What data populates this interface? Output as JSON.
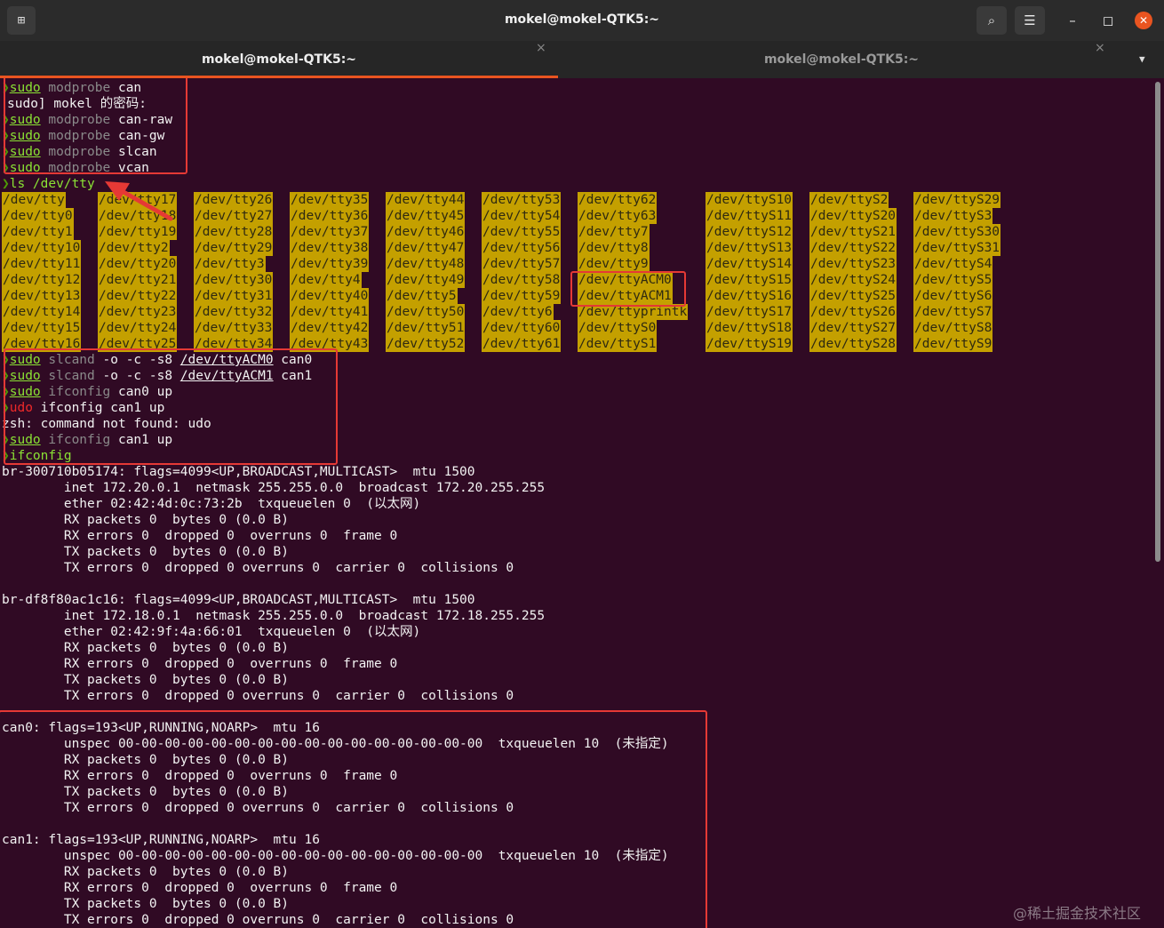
{
  "window": {
    "title": "mokel@mokel-QTK5:~",
    "tabs": [
      {
        "label": "mokel@mokel-QTK5:~",
        "close": "×"
      },
      {
        "label": "mokel@mokel-QTK5:~",
        "close": "×"
      }
    ],
    "new_tab_icon": "⊞",
    "search_icon": "⌕",
    "menu_icon": "☰",
    "minimize_icon": "–",
    "maximize_icon": "◻",
    "close_icon": "✕",
    "tab_dropdown_icon": "▼"
  },
  "colors": {
    "background": "#300a24",
    "accent": "#e95420",
    "highlight_box": "#e53935",
    "dir_bg": "#c4a000",
    "command": "#8ae234"
  },
  "prompt_arrow": "❯",
  "commands_block1": [
    {
      "cmd": "sudo",
      "rest1": "modprobe",
      "rest2": " can"
    },
    {
      "text": "sudo] mokel 的密码:"
    },
    {
      "cmd": "sudo",
      "rest1": "modprobe",
      "rest2": " can-raw"
    },
    {
      "cmd": "sudo",
      "rest1": "modprobe",
      "rest2": " can-gw"
    },
    {
      "cmd": "sudo",
      "rest1": "modprobe",
      "rest2": " slcan"
    },
    {
      "cmd": "sudo",
      "rest1": "modprobe",
      "rest2": " vcan"
    }
  ],
  "ls_command": "ls /dev/tty",
  "tty_columns": [
    [
      "/dev/tty",
      "/dev/tty0",
      "/dev/tty1",
      "/dev/tty10",
      "/dev/tty11",
      "/dev/tty12",
      "/dev/tty13",
      "/dev/tty14",
      "/dev/tty15",
      "/dev/tty16"
    ],
    [
      "/dev/tty17",
      "/dev/tty18",
      "/dev/tty19",
      "/dev/tty2",
      "/dev/tty20",
      "/dev/tty21",
      "/dev/tty22",
      "/dev/tty23",
      "/dev/tty24",
      "/dev/tty25"
    ],
    [
      "/dev/tty26",
      "/dev/tty27",
      "/dev/tty28",
      "/dev/tty29",
      "/dev/tty3",
      "/dev/tty30",
      "/dev/tty31",
      "/dev/tty32",
      "/dev/tty33",
      "/dev/tty34"
    ],
    [
      "/dev/tty35",
      "/dev/tty36",
      "/dev/tty37",
      "/dev/tty38",
      "/dev/tty39",
      "/dev/tty4",
      "/dev/tty40",
      "/dev/tty41",
      "/dev/tty42",
      "/dev/tty43"
    ],
    [
      "/dev/tty44",
      "/dev/tty45",
      "/dev/tty46",
      "/dev/tty47",
      "/dev/tty48",
      "/dev/tty49",
      "/dev/tty5",
      "/dev/tty50",
      "/dev/tty51",
      "/dev/tty52"
    ],
    [
      "/dev/tty53",
      "/dev/tty54",
      "/dev/tty55",
      "/dev/tty56",
      "/dev/tty57",
      "/dev/tty58",
      "/dev/tty59",
      "/dev/tty6",
      "/dev/tty60",
      "/dev/tty61"
    ],
    [
      "/dev/tty62",
      "/dev/tty63",
      "/dev/tty7",
      "/dev/tty8",
      "/dev/tty9",
      "/dev/ttyACM0",
      "/dev/ttyACM1",
      "/dev/ttyprintk",
      "/dev/ttyS0",
      "/dev/ttyS1"
    ],
    [
      "/dev/ttyS10",
      "/dev/ttyS11",
      "/dev/ttyS12",
      "/dev/ttyS13",
      "/dev/ttyS14",
      "/dev/ttyS15",
      "/dev/ttyS16",
      "/dev/ttyS17",
      "/dev/ttyS18",
      "/dev/ttyS19"
    ],
    [
      "/dev/ttyS2",
      "/dev/ttyS20",
      "/dev/ttyS21",
      "/dev/ttyS22",
      "/dev/ttyS23",
      "/dev/ttyS24",
      "/dev/ttyS25",
      "/dev/ttyS26",
      "/dev/ttyS27",
      "/dev/ttyS28"
    ],
    [
      "/dev/ttyS29",
      "/dev/ttyS3",
      "/dev/ttyS30",
      "/dev/ttyS31",
      "/dev/ttyS4",
      "/dev/ttyS5",
      "/dev/ttyS6",
      "/dev/ttyS7",
      "/dev/ttyS8",
      "/dev/ttyS9"
    ]
  ],
  "commands_block2": {
    "l1": {
      "cmd": "sudo",
      "kw": "slcand",
      "a": " -o -c -s8 ",
      "dev": "/dev/ttyACM0",
      "b": " can0"
    },
    "l2": {
      "cmd": "sudo",
      "kw": "slcand",
      "a": " -o -c -s8 ",
      "dev": "/dev/ttyACM1",
      "b": " can1"
    },
    "l3": {
      "cmd": "sudo",
      "kw": "ifconfig",
      "b": " can0 up"
    },
    "l4": {
      "bad": "udo",
      "b": " ifconfig can1 up"
    },
    "l5": "zsh: command not found: udo",
    "l6": {
      "cmd": "sudo",
      "kw": "ifconfig",
      "b": " can1 up"
    },
    "l7": "ifconfig"
  },
  "ifconfig_output": [
    "br-300710b05174: flags=4099<UP,BROADCAST,MULTICAST>  mtu 1500",
    "        inet 172.20.0.1  netmask 255.255.0.0  broadcast 172.20.255.255",
    "        ether 02:42:4d:0c:73:2b  txqueuelen 0  (以太网)",
    "        RX packets 0  bytes 0 (0.0 B)",
    "        RX errors 0  dropped 0  overruns 0  frame 0",
    "        TX packets 0  bytes 0 (0.0 B)",
    "        TX errors 0  dropped 0 overruns 0  carrier 0  collisions 0",
    "",
    "br-df8f80ac1c16: flags=4099<UP,BROADCAST,MULTICAST>  mtu 1500",
    "        inet 172.18.0.1  netmask 255.255.0.0  broadcast 172.18.255.255",
    "        ether 02:42:9f:4a:66:01  txqueuelen 0  (以太网)",
    "        RX packets 0  bytes 0 (0.0 B)",
    "        RX errors 0  dropped 0  overruns 0  frame 0",
    "        TX packets 0  bytes 0 (0.0 B)",
    "        TX errors 0  dropped 0 overruns 0  carrier 0  collisions 0",
    "",
    "can0: flags=193<UP,RUNNING,NOARP>  mtu 16",
    "        unspec 00-00-00-00-00-00-00-00-00-00-00-00-00-00-00-00  txqueuelen 10  (未指定)",
    "        RX packets 0  bytes 0 (0.0 B)",
    "        RX errors 0  dropped 0  overruns 0  frame 0",
    "        TX packets 0  bytes 0 (0.0 B)",
    "        TX errors 0  dropped 0 overruns 0  carrier 0  collisions 0",
    "",
    "can1: flags=193<UP,RUNNING,NOARP>  mtu 16",
    "        unspec 00-00-00-00-00-00-00-00-00-00-00-00-00-00-00-00  txqueuelen 10  (未指定)",
    "        RX packets 0  bytes 0 (0.0 B)",
    "        RX errors 0  dropped 0  overruns 0  frame 0",
    "        TX packets 0  bytes 0 (0.0 B)",
    "        TX errors 0  dropped 0 overruns 0  carrier 0  collisions 0"
  ],
  "watermark": "@稀土掘金技术社区"
}
